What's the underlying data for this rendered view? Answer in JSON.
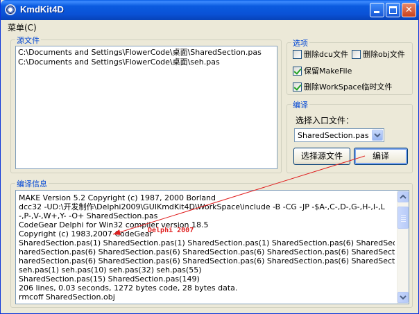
{
  "window": {
    "title": "KmdKit4D",
    "minimize_label": "_",
    "close_label": "✕"
  },
  "menu": {
    "items": [
      {
        "label": "菜单(C)"
      }
    ]
  },
  "source_files": {
    "label": "源文件",
    "items": [
      "C:\\Documents and Settings\\FlowerCode\\桌面\\SharedSection.pas",
      "C:\\Documents and Settings\\FlowerCode\\桌面\\seh.pas"
    ]
  },
  "options": {
    "label": "选项",
    "delete_dcu": {
      "label": "删除dcu文件",
      "checked": false
    },
    "delete_obj": {
      "label": "删除obj文件",
      "checked": false
    },
    "keep_makefile": {
      "label": "保留MakeFile",
      "checked": true
    },
    "delete_workspace": {
      "label": "删除WorkSpace临时文件",
      "checked": true
    }
  },
  "compile": {
    "label": "编译",
    "entry_label": "选择入口文件：",
    "entry_value": "SharedSection.pas",
    "select_source_button": "选择源文件",
    "compile_button": "编译"
  },
  "compile_info": {
    "label": "编译信息",
    "lines": [
      "MAKE Version 5.2  Copyright (c) 1987, 2000 Borland",
      "        dcc32 -UD:\\开发制作\\Delphi2009\\GUIKmdKit4D\\WorkSpace\\include -B -CG -JP -$A-,C-,D-,G-,H-,I-,L",
      "-,P-,V-,W+,Y- -O+ SharedSection.pas",
      "CodeGear Delphi for Win32 compiler version 18.5",
      "Copyright (c) 1983,2007 CodeGear",
      "SharedSection.pas(1) SharedSection.pas(1) SharedSection.pas(1) SharedSection.pas(6) SharedSection.pas(6) S",
      "haredSection.pas(6) SharedSection.pas(6) SharedSection.pas(6) SharedSection.pas(6) SharedSection.pas(6) S",
      "haredSection.pas(6) SharedSection.pas(6) SharedSection.pas(6) SharedSection.pas(6) SharedSection.pas(8)",
      "seh.pas(1)          seh.pas(10) seh.pas(32) seh.pas(55)",
      "SharedSection.pas(15) SharedSection.pas(149)",
      "206 lines, 0.03 seconds, 1272 bytes code, 28 bytes data.",
      "        rmcoff SharedSection.obj"
    ]
  },
  "annotation": {
    "text": "Delphi 2007",
    "color": "#e02020"
  },
  "colors": {
    "titlebar": "#0a52d6",
    "group_label": "#0046d5",
    "window_bg": "#ece9d8"
  }
}
